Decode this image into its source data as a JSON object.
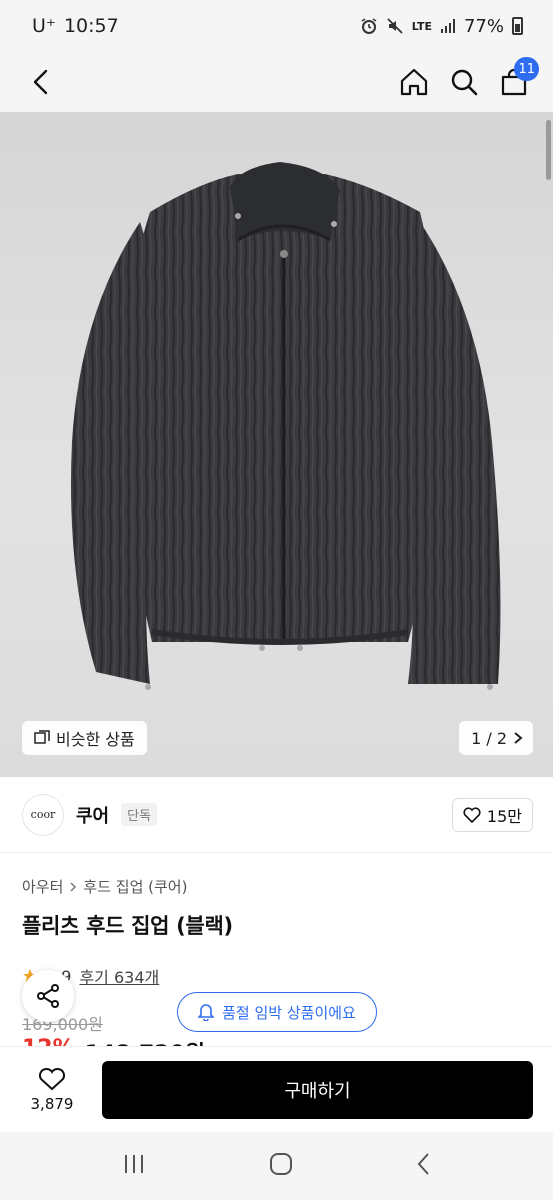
{
  "status_bar": {
    "carrier": "U⁺",
    "time": "10:57",
    "network": "LTE",
    "battery": "77%"
  },
  "header": {
    "cart_count": "11"
  },
  "gallery": {
    "similar_label": "비슷한 상품",
    "pager": "1 / 2"
  },
  "brand": {
    "logo_text": "coor",
    "name": "쿠어",
    "tag": "단독",
    "likes": "15만"
  },
  "product": {
    "breadcrumb": [
      "아우터",
      "후드 집업 (쿠어)"
    ],
    "title": "플리츠 후드 집업 (블랙)",
    "rating": "4.9",
    "review_text": "후기 634개",
    "original_price": "169,000원",
    "discount": "12%",
    "sale_price": "148,720원"
  },
  "restock_notice": "품절 임박 상품이에요",
  "bottom": {
    "wish_count": "3,879",
    "buy_label": "구매하기"
  },
  "colors": {
    "accent": "#2f6df0",
    "discount": "#e8342c",
    "button": "#000000"
  }
}
